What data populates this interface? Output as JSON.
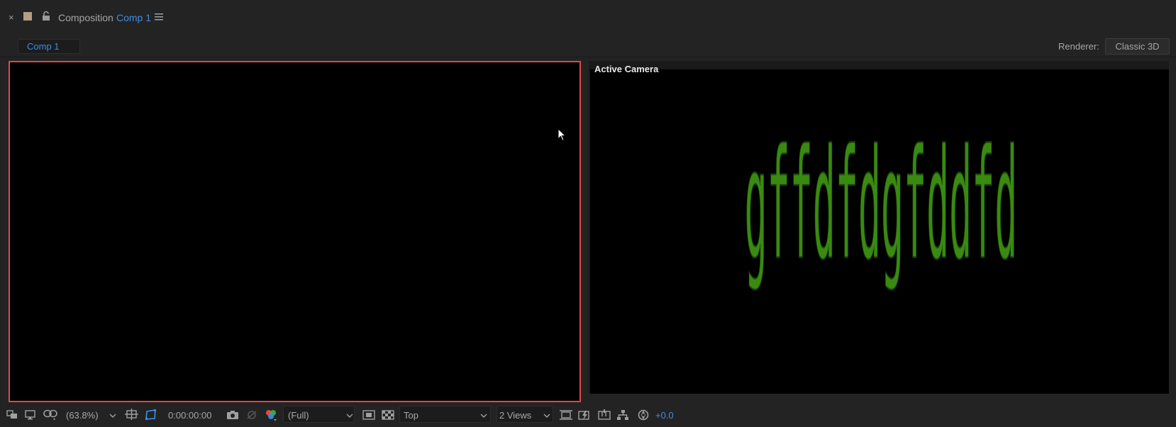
{
  "title_bar": {
    "close_glyph": "×",
    "panel_label": "Composition",
    "comp_name": "Comp 1",
    "icons": [
      "close-icon",
      "color-label-swatch",
      "lock-icon",
      "panel-menu-icon"
    ],
    "swatch_color": "#b49f83"
  },
  "tab_bar": {
    "comp_tab": "Comp 1",
    "renderer_label": "Renderer:",
    "renderer_value": "Classic 3D"
  },
  "viewers": {
    "left": {
      "active": true,
      "highlight_color": "#e04848"
    },
    "right": {
      "view_label": "Active Camera",
      "text_layer": "gffdfdgfddfd",
      "text_color": "#3a8a12"
    }
  },
  "toolbar": {
    "zoom": "(63.8%)",
    "timecode": "0:00:00:00",
    "resolution": "(Full)",
    "view": "Top",
    "layout": "2 Views",
    "exposure": "+0.0",
    "accent_color": "#3d8fe4"
  }
}
